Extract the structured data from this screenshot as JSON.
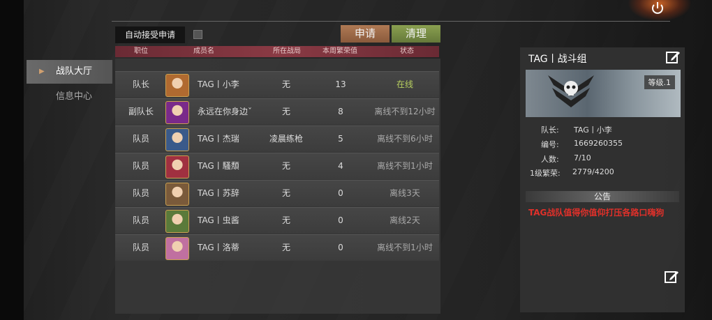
{
  "nav": {
    "items": [
      {
        "label": "战队大厅",
        "active": true
      },
      {
        "label": "信息中心",
        "active": false
      }
    ]
  },
  "controls": {
    "auto_accept_label": "自动接受申请",
    "apply_label": "申请",
    "clear_label": "清理"
  },
  "table": {
    "headers": {
      "role": "职位",
      "member": "成员名",
      "match": "所在战局",
      "weekly": "本周繁荣值",
      "status": "状态"
    },
    "rows": [
      {
        "role": "队长",
        "name": "TAG丨小李",
        "match": "无",
        "weekly": "13",
        "status": "在线",
        "online": true,
        "avatar_color": "#b06a30"
      },
      {
        "role": "副队长",
        "name": "永远在你身边ˇ",
        "match": "无",
        "weekly": "8",
        "status": "离线不到12小时",
        "online": false,
        "avatar_color": "#7a2a8a"
      },
      {
        "role": "队员",
        "name": "TAG丨杰瑞",
        "match": "凌晨练枪",
        "weekly": "5",
        "status": "离线不到6小时",
        "online": false,
        "avatar_color": "#3a5a8a"
      },
      {
        "role": "队员",
        "name": "TAG丨騷頽",
        "match": "无",
        "weekly": "4",
        "status": "离线不到1小时",
        "online": false,
        "avatar_color": "#a03040"
      },
      {
        "role": "队员",
        "name": "TAG丨苏辞",
        "match": "无",
        "weekly": "0",
        "status": "离线3天",
        "online": false,
        "avatar_color": "#7a5a3a"
      },
      {
        "role": "队员",
        "name": "TAG丨虫酱",
        "match": "无",
        "weekly": "0",
        "status": "离线2天",
        "online": false,
        "avatar_color": "#5a7a3a"
      },
      {
        "role": "队员",
        "name": "TAG丨洛蒂",
        "match": "无",
        "weekly": "0",
        "status": "离线不到1小时",
        "online": false,
        "avatar_color": "#c070a0"
      }
    ]
  },
  "team": {
    "title": "TAG丨战斗组",
    "level": "等级.1",
    "captain_label": "队长:",
    "captain_value": "TAG丨小李",
    "id_label": "编号:",
    "id_value": "1669260355",
    "count_label": "人数:",
    "count_value": "7/10",
    "prosperity_label": "1级繁荣:",
    "prosperity_value": "2779/4200",
    "announcement_title": "公告",
    "announcement_text": "TAG战队值得你值仰打压各路口嗨狗"
  },
  "colors": {
    "online": "#b8d060",
    "offline": "#aaaaaa",
    "announcement": "#e0302a"
  }
}
